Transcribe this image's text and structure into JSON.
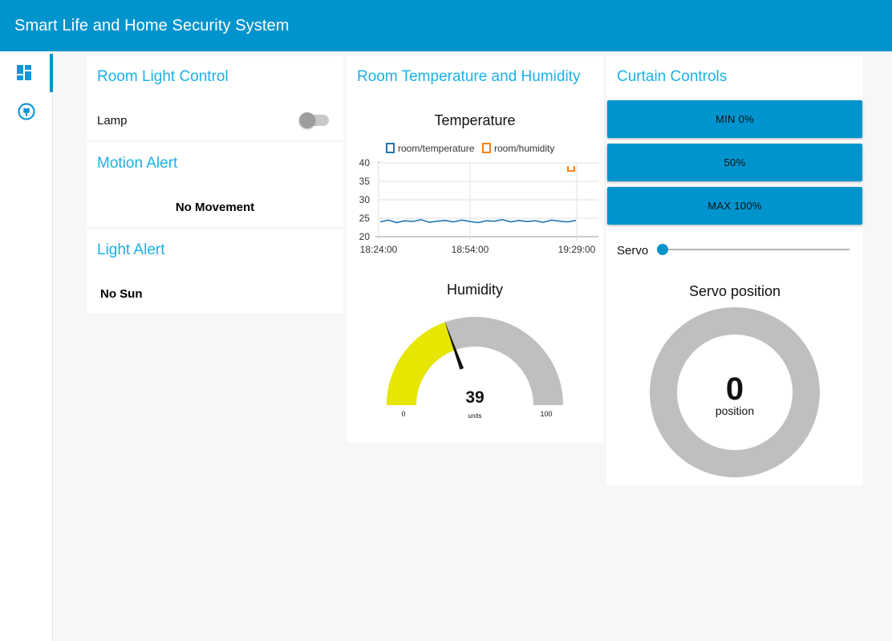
{
  "app": {
    "title": "Smart Life and Home Security System"
  },
  "sidebar": {
    "items": [
      {
        "icon": "dashboard-icon"
      },
      {
        "icon": "github-icon"
      }
    ]
  },
  "room_light": {
    "title": "Room Light Control",
    "lamp_label": "Lamp",
    "lamp_on": false
  },
  "motion": {
    "title": "Motion Alert",
    "status": "No Movement"
  },
  "light_alert": {
    "title": "Light Alert",
    "status": "No Sun"
  },
  "room_temp": {
    "title": "Room Temperature and Humidity",
    "chart_title": "Temperature",
    "humidity_title": "Humidity",
    "humidity_value": "39",
    "humidity_units": "units",
    "humidity_min": "0",
    "humidity_max": "100"
  },
  "chart_data": {
    "type": "line",
    "title": "Temperature",
    "series": [
      {
        "name": "room/temperature",
        "color": "#1f77b4",
        "values": [
          24,
          24.5,
          23.8,
          24.3,
          24.1,
          24.6,
          23.9,
          24.2,
          24.4,
          24.0,
          24.5,
          24.1,
          23.8,
          24.3,
          24.2,
          24.6,
          24.0,
          24.4,
          24.1,
          24.3,
          23.9,
          24.5,
          24.2,
          24.0,
          24.4
        ]
      },
      {
        "name": "room/humidity",
        "color": "#ff7f0e",
        "values": [
          39
        ]
      }
    ],
    "x_ticks": [
      "18:24:00",
      "18:54:00",
      "19:29:00"
    ],
    "y_ticks": [
      "40",
      "35",
      "30",
      "25",
      "20"
    ],
    "ylim": [
      20,
      40
    ],
    "legend": "top",
    "grid": true
  },
  "curtain": {
    "title": "Curtain Controls",
    "btn_min": "MIN 0%",
    "btn_mid": "50%",
    "btn_max": "MAX 100%",
    "servo_label": "Servo",
    "servo_value": 0,
    "position_title": "Servo position",
    "position_value": "0",
    "position_label": "position"
  },
  "colors": {
    "accent": "#0094ce",
    "title_text": "#1bb1e6",
    "gauge_fill": "#e6e600",
    "gauge_bg": "#bfbfbf"
  }
}
